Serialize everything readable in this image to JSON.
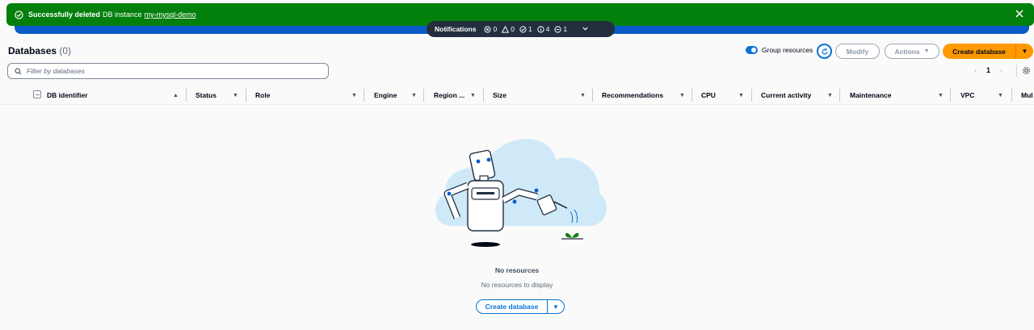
{
  "flash": {
    "bold_text": "Successfully deleted",
    "text": "DB instance",
    "link": "my-mysql-demo"
  },
  "notifications": {
    "title": "Notifications",
    "error_count": "0",
    "warning_count": "0",
    "success_count": "1",
    "info_count": "4",
    "in_progress_count": "1"
  },
  "header": {
    "title": "Databases",
    "count": "(0)"
  },
  "toolbar": {
    "group_resources_label": "Group resources",
    "modify_label": "Modify",
    "actions_label": "Actions",
    "create_label": "Create database"
  },
  "filter": {
    "placeholder": "Filter by databases"
  },
  "pagination": {
    "current_page": "1"
  },
  "table": {
    "columns": [
      "DB identifier",
      "Status",
      "Role",
      "Engine",
      "Region ...",
      "Size",
      "Recommendations",
      "CPU",
      "Current activity",
      "Maintenance",
      "VPC",
      "Mul"
    ]
  },
  "empty_state": {
    "title": "No resources",
    "subtitle": "No resources to display",
    "button_label": "Create database"
  },
  "colors": {
    "success": "#037f0c",
    "accent": "#0972d3",
    "primary_button": "#ff9900",
    "notification_bar": "#232f3e"
  }
}
